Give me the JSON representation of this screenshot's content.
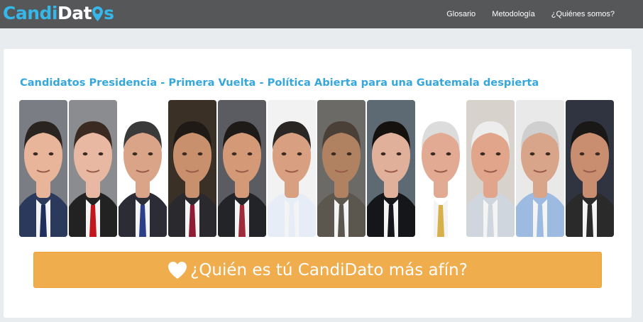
{
  "navbar": {
    "logo": {
      "part1": "Candi",
      "part2": "Dat",
      "part3": "s"
    },
    "links": [
      "Glosario",
      "Metodología",
      "¿Quiénes somos?"
    ]
  },
  "main": {
    "title": "Candidatos Presidencia - Primera Vuelta - Política Abierta para una Guatemala despierta",
    "cta_label": "¿Quién es tú CandiDato más afín?",
    "cta_icon": "heart-icon"
  },
  "candidates": [
    {
      "skin": "#e8b49a",
      "hair": "#2a2420",
      "bg": "#7a7e84",
      "jacket": "#2b3a5c",
      "tie": "#1d2f5a"
    },
    {
      "skin": "#e9b8a2",
      "hair": "#3a2a22",
      "bg": "#8a8c90",
      "jacket": "#222222",
      "tie": "#c2161d"
    },
    {
      "skin": "#d9a488",
      "hair": "#3a3a3a",
      "bg": "#ffffff",
      "jacket": "#2c2c36",
      "tie": "#2e3f8a"
    },
    {
      "skin": "#c9906e",
      "hair": "#1f1a16",
      "bg": "#3b3026",
      "jacket": "#2a2a2e",
      "tie": "#8e1d33"
    },
    {
      "skin": "#d49a78",
      "hair": "#1e1a18",
      "bg": "#5a5c62",
      "jacket": "#222428",
      "tie": "#9e2a3a"
    },
    {
      "skin": "#d8a080",
      "hair": "#2a2624",
      "bg": "#f2f2f2",
      "jacket": "#e6edf6",
      "tie": "#e6edf6"
    },
    {
      "skin": "#b08262",
      "hair": "#4a4038",
      "bg": "#6c6a66",
      "jacket": "#5b564e",
      "tie": "#5b564e"
    },
    {
      "skin": "#e0b09a",
      "hair": "#14110f",
      "bg": "#5d6a74",
      "jacket": "#15161a",
      "tie": "#15161a"
    },
    {
      "skin": "#e2aa92",
      "hair": "#dcdcdc",
      "bg": "#ffffff",
      "jacket": "#ffffff",
      "tie": "#d7b04a"
    },
    {
      "skin": "#e0a58a",
      "hair": "#ededed",
      "bg": "#d8d2cc",
      "jacket": "#cfd6de",
      "tie": "#cfd6de"
    },
    {
      "skin": "#d8a48a",
      "hair": "#cfcfcf",
      "bg": "#e9e9e9",
      "jacket": "#9dbbe0",
      "tie": "#9dbbe0"
    },
    {
      "skin": "#c98d70",
      "hair": "#1a1816",
      "bg": "#2f3440",
      "jacket": "#2a2a2a",
      "tie": "#2a2a2a"
    }
  ]
}
